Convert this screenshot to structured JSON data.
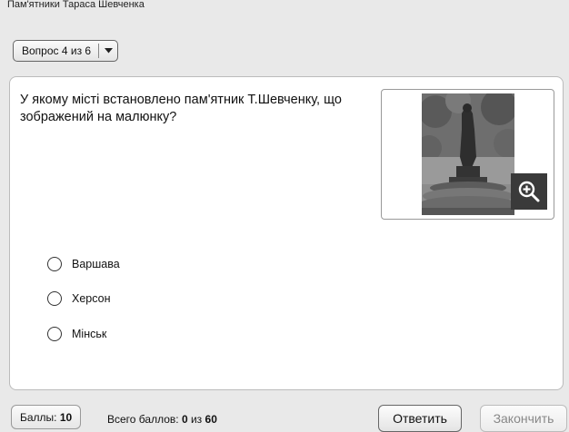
{
  "window": {
    "title": "Пам'ятники Тараса Шевченка"
  },
  "nav": {
    "question_counter": "Вопрос 4 из 6"
  },
  "question": {
    "text": "У якому місті встановлено пам'ятник Т.Шевченку, що зображений на малюнку?",
    "image_icon": "zoom-in-icon"
  },
  "options": [
    {
      "label": "Варшава"
    },
    {
      "label": "Херсон"
    },
    {
      "label": "Мінськ"
    }
  ],
  "footer": {
    "score_label": "Баллы:",
    "score_value": "10",
    "total_label": "Всего баллов:",
    "total_value": "0",
    "total_sep": "из",
    "total_max": "60",
    "answer_label": "Ответить",
    "finish_label": "Закончить"
  }
}
